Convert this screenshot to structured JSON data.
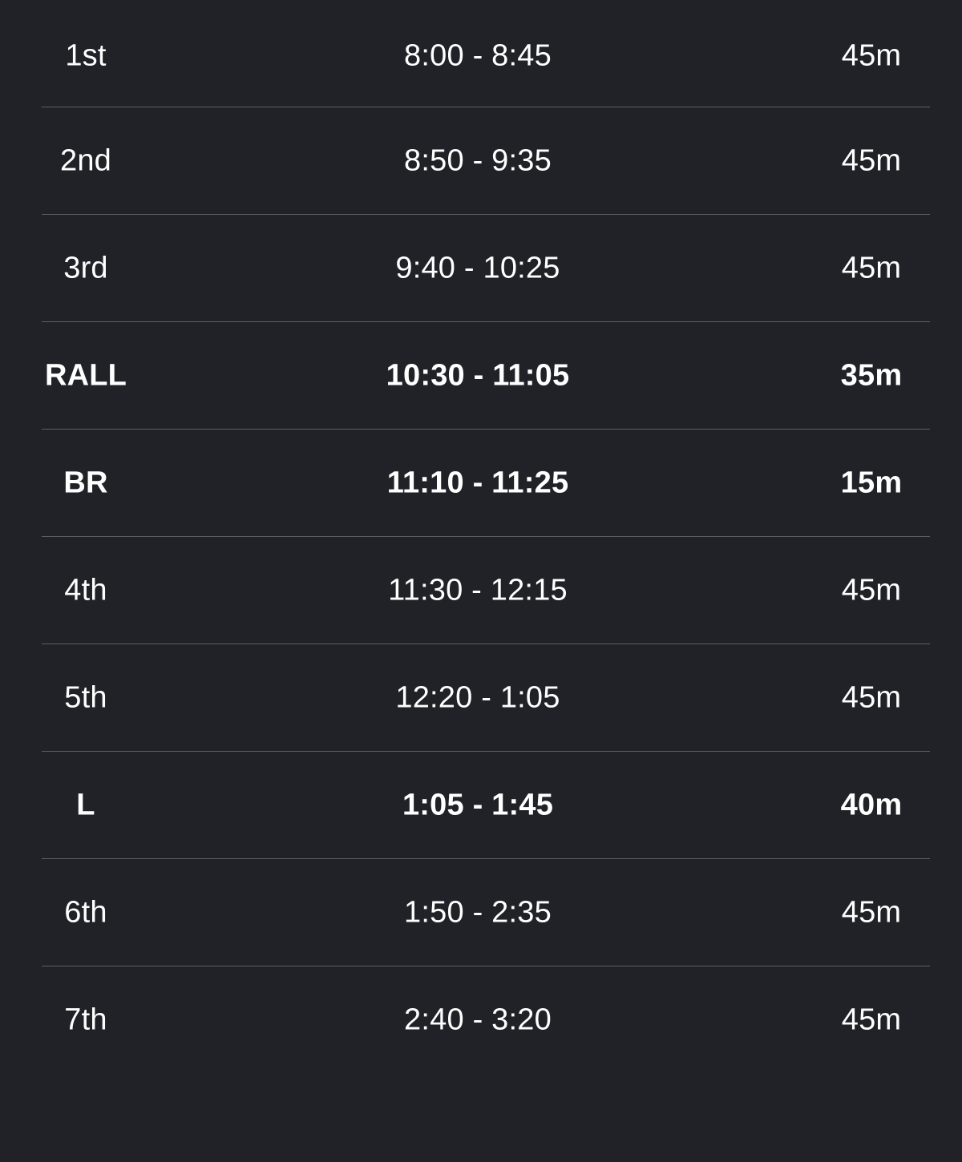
{
  "schedule": {
    "rows": [
      {
        "label": "1st",
        "time": "8:00 - 8:45",
        "duration": "45m",
        "bold": false
      },
      {
        "label": "2nd",
        "time": "8:50 - 9:35",
        "duration": "45m",
        "bold": false
      },
      {
        "label": "3rd",
        "time": "9:40 - 10:25",
        "duration": "45m",
        "bold": false
      },
      {
        "label": "RALL",
        "time": "10:30 - 11:05",
        "duration": "35m",
        "bold": true
      },
      {
        "label": "BR",
        "time": "11:10 - 11:25",
        "duration": "15m",
        "bold": true
      },
      {
        "label": "4th",
        "time": "11:30 - 12:15",
        "duration": "45m",
        "bold": false
      },
      {
        "label": "5th",
        "time": "12:20 - 1:05",
        "duration": "45m",
        "bold": false
      },
      {
        "label": "L",
        "time": "1:05 - 1:45",
        "duration": "40m",
        "bold": true
      },
      {
        "label": "6th",
        "time": "1:50 - 2:35",
        "duration": "45m",
        "bold": false
      },
      {
        "label": "7th",
        "time": "2:40 - 3:20",
        "duration": "45m",
        "bold": false
      }
    ]
  },
  "colors": {
    "background": "#212228",
    "text": "#ffffff",
    "divider": "#5e5f63"
  }
}
